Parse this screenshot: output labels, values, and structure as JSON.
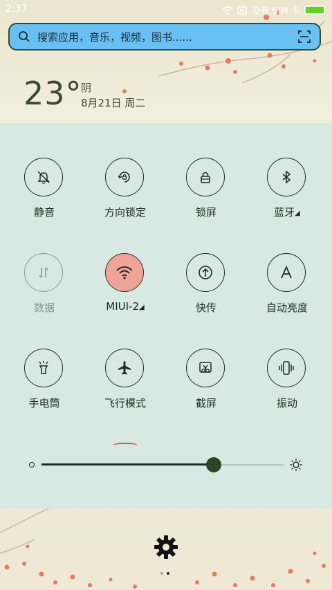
{
  "status_bar": {
    "time": "2:37",
    "sim_text": "没有 SIM 卡",
    "colors": {
      "battery": "#5cd42a"
    }
  },
  "search": {
    "placeholder": "搜索应用，音乐，视频，图书......",
    "icons": [
      "search-icon",
      "scan-icon"
    ],
    "colors": {
      "background": "#69c0f2"
    }
  },
  "weather": {
    "temperature": "23°",
    "condition": "阴",
    "date": "8月21日 周二"
  },
  "toggles": [
    {
      "label": "静音",
      "icon": "mute-icon",
      "state": "off"
    },
    {
      "label": "方向锁定",
      "icon": "rotation-lock-icon",
      "state": "off"
    },
    {
      "label": "锁屏",
      "icon": "lock-icon",
      "state": "off"
    },
    {
      "label": "蓝牙",
      "icon": "bluetooth-icon",
      "state": "off",
      "has_submenu": true
    },
    {
      "label": "数据",
      "icon": "mobile-data-icon",
      "state": "disabled"
    },
    {
      "label": "MIUI-2",
      "icon": "wifi-icon",
      "state": "on",
      "has_submenu": true
    },
    {
      "label": "快传",
      "icon": "quick-transfer-icon",
      "state": "off"
    },
    {
      "label": "自动亮度",
      "icon": "auto-brightness-icon",
      "state": "off"
    },
    {
      "label": "手电筒",
      "icon": "flashlight-icon",
      "state": "off"
    },
    {
      "label": "飞行模式",
      "icon": "airplane-icon",
      "state": "off"
    },
    {
      "label": "截屏",
      "icon": "screenshot-icon",
      "state": "off"
    },
    {
      "label": "振动",
      "icon": "vibrate-icon",
      "state": "off"
    }
  ],
  "brightness": {
    "level": 0.71
  },
  "colors": {
    "panel": "#d8e8e3",
    "active_toggle": "#f0a399",
    "slider_thumb": "#2f4327"
  },
  "bottom": {
    "icon": "gear-icon",
    "pages": 2,
    "current_page": 2
  }
}
